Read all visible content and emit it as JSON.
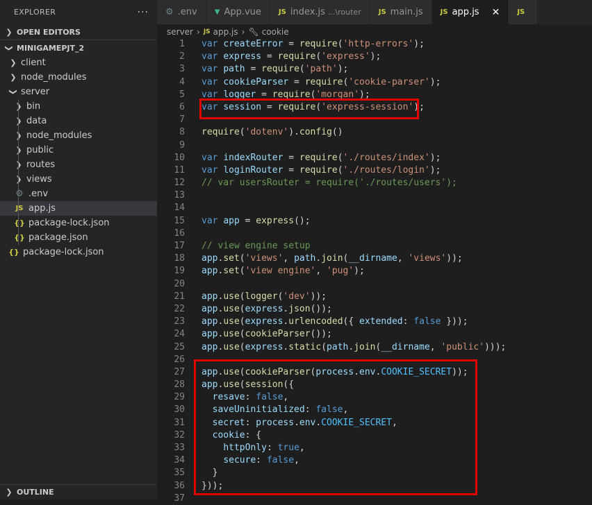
{
  "sidebar": {
    "header": "EXPLORER",
    "more": "···",
    "open_editors": "OPEN EDITORS",
    "project": "MINIGAMEPJT_2",
    "tree": [
      {
        "label": "client",
        "type": "folder",
        "indent": 1
      },
      {
        "label": "node_modules",
        "type": "folder",
        "indent": 1
      },
      {
        "label": "server",
        "type": "folder-open",
        "indent": 1
      },
      {
        "label": "bin",
        "type": "folder",
        "indent": 2
      },
      {
        "label": "data",
        "type": "folder",
        "indent": 2
      },
      {
        "label": "node_modules",
        "type": "folder",
        "indent": 2
      },
      {
        "label": "public",
        "type": "folder",
        "indent": 2
      },
      {
        "label": "routes",
        "type": "folder",
        "indent": 2
      },
      {
        "label": "views",
        "type": "folder",
        "indent": 2
      },
      {
        "label": ".env",
        "type": "env",
        "indent": 2
      },
      {
        "label": "app.js",
        "type": "js",
        "indent": 2,
        "selected": true
      },
      {
        "label": "package-lock.json",
        "type": "json",
        "indent": 2
      },
      {
        "label": "package.json",
        "type": "json",
        "indent": 2
      },
      {
        "label": "package-lock.json",
        "type": "json",
        "indent": 1
      }
    ],
    "outline": "OUTLINE"
  },
  "tabs": [
    {
      "label": ".env",
      "icon": "gear-icon"
    },
    {
      "label": "App.vue",
      "icon": "vue-icon"
    },
    {
      "label": "index.js",
      "desc": "...\\router",
      "icon": "js-icon"
    },
    {
      "label": "main.js",
      "icon": "js-icon"
    },
    {
      "label": "app.js",
      "icon": "js-icon",
      "active": true,
      "close": "✕"
    },
    {
      "label": "",
      "icon": "js-icon"
    }
  ],
  "breadcrumb": {
    "folder": "server",
    "file": "app.js",
    "symbol": "cookie"
  },
  "colors": {
    "highlight": "#e00000",
    "selected_row": "#37373d"
  },
  "code_lines": [
    {
      "n": "1",
      "tokens": [
        [
          "kw",
          "var "
        ],
        [
          "vr",
          "createError"
        ],
        [
          "pn",
          " = "
        ],
        [
          "fn",
          "require"
        ],
        [
          "pn",
          "("
        ],
        [
          "st",
          "'http-errors'"
        ],
        [
          "pn",
          ");"
        ]
      ]
    },
    {
      "n": "2",
      "tokens": [
        [
          "kw",
          "var "
        ],
        [
          "vr",
          "express"
        ],
        [
          "pn",
          " = "
        ],
        [
          "fn",
          "require"
        ],
        [
          "pn",
          "("
        ],
        [
          "st",
          "'express'"
        ],
        [
          "pn",
          ");"
        ]
      ]
    },
    {
      "n": "3",
      "tokens": [
        [
          "kw",
          "var "
        ],
        [
          "vr",
          "path"
        ],
        [
          "pn",
          " = "
        ],
        [
          "fn",
          "require"
        ],
        [
          "pn",
          "("
        ],
        [
          "st",
          "'path'"
        ],
        [
          "pn",
          ");"
        ]
      ]
    },
    {
      "n": "4",
      "tokens": [
        [
          "kw",
          "var "
        ],
        [
          "vr",
          "cookieParser"
        ],
        [
          "pn",
          " = "
        ],
        [
          "fn",
          "require"
        ],
        [
          "pn",
          "("
        ],
        [
          "st",
          "'cookie-parser'"
        ],
        [
          "pn",
          ");"
        ]
      ]
    },
    {
      "n": "5",
      "tokens": [
        [
          "kw",
          "var "
        ],
        [
          "vr",
          "logger"
        ],
        [
          "pn",
          " = "
        ],
        [
          "fn",
          "require"
        ],
        [
          "pn",
          "("
        ],
        [
          "st",
          "'morgan'"
        ],
        [
          "pn",
          ");"
        ]
      ]
    },
    {
      "n": "6",
      "tokens": [
        [
          "kw",
          "var "
        ],
        [
          "vr",
          "session"
        ],
        [
          "pn",
          " = "
        ],
        [
          "fn",
          "require"
        ],
        [
          "pn",
          "("
        ],
        [
          "st",
          "'express-session'"
        ],
        [
          "pn",
          ");"
        ]
      ]
    },
    {
      "n": "7",
      "tokens": []
    },
    {
      "n": "8",
      "tokens": [
        [
          "fn",
          "require"
        ],
        [
          "pn",
          "("
        ],
        [
          "st",
          "'dotenv'"
        ],
        [
          "pn",
          ")."
        ],
        [
          "fn",
          "config"
        ],
        [
          "pn",
          "()"
        ]
      ]
    },
    {
      "n": "9",
      "tokens": []
    },
    {
      "n": "10",
      "tokens": [
        [
          "kw",
          "var "
        ],
        [
          "vr",
          "indexRouter"
        ],
        [
          "pn",
          " = "
        ],
        [
          "fn",
          "require"
        ],
        [
          "pn",
          "("
        ],
        [
          "st",
          "'./routes/index'"
        ],
        [
          "pn",
          ");"
        ]
      ]
    },
    {
      "n": "11",
      "tokens": [
        [
          "kw",
          "var "
        ],
        [
          "vr",
          "loginRouter"
        ],
        [
          "pn",
          " = "
        ],
        [
          "fn",
          "require"
        ],
        [
          "pn",
          "("
        ],
        [
          "st",
          "'./routes/login'"
        ],
        [
          "pn",
          ");"
        ]
      ]
    },
    {
      "n": "12",
      "tokens": [
        [
          "cm",
          "// var usersRouter = require('./routes/users');"
        ]
      ]
    },
    {
      "n": "13",
      "tokens": []
    },
    {
      "n": "14",
      "tokens": []
    },
    {
      "n": "15",
      "tokens": [
        [
          "kw",
          "var "
        ],
        [
          "vr",
          "app"
        ],
        [
          "pn",
          " = "
        ],
        [
          "fn",
          "express"
        ],
        [
          "pn",
          "();"
        ]
      ]
    },
    {
      "n": "16",
      "tokens": []
    },
    {
      "n": "17",
      "tokens": [
        [
          "cm",
          "// view engine setup"
        ]
      ]
    },
    {
      "n": "18",
      "tokens": [
        [
          "vr",
          "app"
        ],
        [
          "pn",
          "."
        ],
        [
          "fn",
          "set"
        ],
        [
          "pn",
          "("
        ],
        [
          "st",
          "'views'"
        ],
        [
          "pn",
          ", "
        ],
        [
          "vr",
          "path"
        ],
        [
          "pn",
          "."
        ],
        [
          "fn",
          "join"
        ],
        [
          "pn",
          "("
        ],
        [
          "vr",
          "__dirname"
        ],
        [
          "pn",
          ", "
        ],
        [
          "st",
          "'views'"
        ],
        [
          "pn",
          "));"
        ]
      ]
    },
    {
      "n": "19",
      "tokens": [
        [
          "vr",
          "app"
        ],
        [
          "pn",
          "."
        ],
        [
          "fn",
          "set"
        ],
        [
          "pn",
          "("
        ],
        [
          "st",
          "'view engine'"
        ],
        [
          "pn",
          ", "
        ],
        [
          "st",
          "'pug'"
        ],
        [
          "pn",
          ");"
        ]
      ]
    },
    {
      "n": "20",
      "tokens": []
    },
    {
      "n": "21",
      "tokens": [
        [
          "vr",
          "app"
        ],
        [
          "pn",
          "."
        ],
        [
          "fn",
          "use"
        ],
        [
          "pn",
          "("
        ],
        [
          "fn",
          "logger"
        ],
        [
          "pn",
          "("
        ],
        [
          "st",
          "'dev'"
        ],
        [
          "pn",
          "));"
        ]
      ]
    },
    {
      "n": "22",
      "tokens": [
        [
          "vr",
          "app"
        ],
        [
          "pn",
          "."
        ],
        [
          "fn",
          "use"
        ],
        [
          "pn",
          "("
        ],
        [
          "vr",
          "express"
        ],
        [
          "pn",
          "."
        ],
        [
          "fn",
          "json"
        ],
        [
          "pn",
          "());"
        ]
      ]
    },
    {
      "n": "23",
      "tokens": [
        [
          "vr",
          "app"
        ],
        [
          "pn",
          "."
        ],
        [
          "fn",
          "use"
        ],
        [
          "pn",
          "("
        ],
        [
          "vr",
          "express"
        ],
        [
          "pn",
          "."
        ],
        [
          "fn",
          "urlencoded"
        ],
        [
          "pn",
          "({ "
        ],
        [
          "vr",
          "extended"
        ],
        [
          "pn",
          ": "
        ],
        [
          "kw",
          "false"
        ],
        [
          "pn",
          " }));"
        ]
      ]
    },
    {
      "n": "24",
      "tokens": [
        [
          "vr",
          "app"
        ],
        [
          "pn",
          "."
        ],
        [
          "fn",
          "use"
        ],
        [
          "pn",
          "("
        ],
        [
          "fn",
          "cookieParser"
        ],
        [
          "pn",
          "());"
        ]
      ]
    },
    {
      "n": "25",
      "tokens": [
        [
          "vr",
          "app"
        ],
        [
          "pn",
          "."
        ],
        [
          "fn",
          "use"
        ],
        [
          "pn",
          "("
        ],
        [
          "vr",
          "express"
        ],
        [
          "pn",
          "."
        ],
        [
          "fn",
          "static"
        ],
        [
          "pn",
          "("
        ],
        [
          "vr",
          "path"
        ],
        [
          "pn",
          "."
        ],
        [
          "fn",
          "join"
        ],
        [
          "pn",
          "("
        ],
        [
          "vr",
          "__dirname"
        ],
        [
          "pn",
          ", "
        ],
        [
          "st",
          "'public'"
        ],
        [
          "pn",
          ")));"
        ]
      ]
    },
    {
      "n": "26",
      "tokens": []
    },
    {
      "n": "27",
      "tokens": [
        [
          "vr",
          "app"
        ],
        [
          "pn",
          "."
        ],
        [
          "fn",
          "use"
        ],
        [
          "pn",
          "("
        ],
        [
          "fn",
          "cookieParser"
        ],
        [
          "pn",
          "("
        ],
        [
          "vr",
          "process"
        ],
        [
          "pn",
          "."
        ],
        [
          "vr",
          "env"
        ],
        [
          "pn",
          "."
        ],
        [
          "cn",
          "COOKIE_SECRET"
        ],
        [
          "pn",
          "));"
        ]
      ]
    },
    {
      "n": "28",
      "tokens": [
        [
          "vr",
          "app"
        ],
        [
          "pn",
          "."
        ],
        [
          "fn",
          "use"
        ],
        [
          "pn",
          "("
        ],
        [
          "fn",
          "session"
        ],
        [
          "pn",
          "({"
        ]
      ]
    },
    {
      "n": "29",
      "tokens": [
        [
          "pn",
          "  "
        ],
        [
          "vr",
          "resave"
        ],
        [
          "pn",
          ": "
        ],
        [
          "kw",
          "false"
        ],
        [
          "pn",
          ","
        ]
      ]
    },
    {
      "n": "30",
      "tokens": [
        [
          "pn",
          "  "
        ],
        [
          "vr",
          "saveUninitialized"
        ],
        [
          "pn",
          ": "
        ],
        [
          "kw",
          "false"
        ],
        [
          "pn",
          ","
        ]
      ]
    },
    {
      "n": "31",
      "tokens": [
        [
          "pn",
          "  "
        ],
        [
          "vr",
          "secret"
        ],
        [
          "pn",
          ": "
        ],
        [
          "vr",
          "process"
        ],
        [
          "pn",
          "."
        ],
        [
          "vr",
          "env"
        ],
        [
          "pn",
          "."
        ],
        [
          "cn",
          "COOKIE_SECRET"
        ],
        [
          "pn",
          ","
        ]
      ]
    },
    {
      "n": "32",
      "tokens": [
        [
          "pn",
          "  "
        ],
        [
          "vr",
          "cookie"
        ],
        [
          "pn",
          ": {"
        ]
      ]
    },
    {
      "n": "33",
      "tokens": [
        [
          "pn",
          "    "
        ],
        [
          "vr",
          "httpOnly"
        ],
        [
          "pn",
          ": "
        ],
        [
          "kw",
          "true"
        ],
        [
          "pn",
          ","
        ]
      ]
    },
    {
      "n": "34",
      "tokens": [
        [
          "pn",
          "    "
        ],
        [
          "vr",
          "secure"
        ],
        [
          "pn",
          ": "
        ],
        [
          "kw",
          "false"
        ],
        [
          "pn",
          ","
        ]
      ]
    },
    {
      "n": "35",
      "tokens": [
        [
          "pn",
          "  }"
        ]
      ]
    },
    {
      "n": "36",
      "tokens": [
        [
          "pn",
          "}));"
        ]
      ]
    },
    {
      "n": "37",
      "tokens": []
    }
  ]
}
